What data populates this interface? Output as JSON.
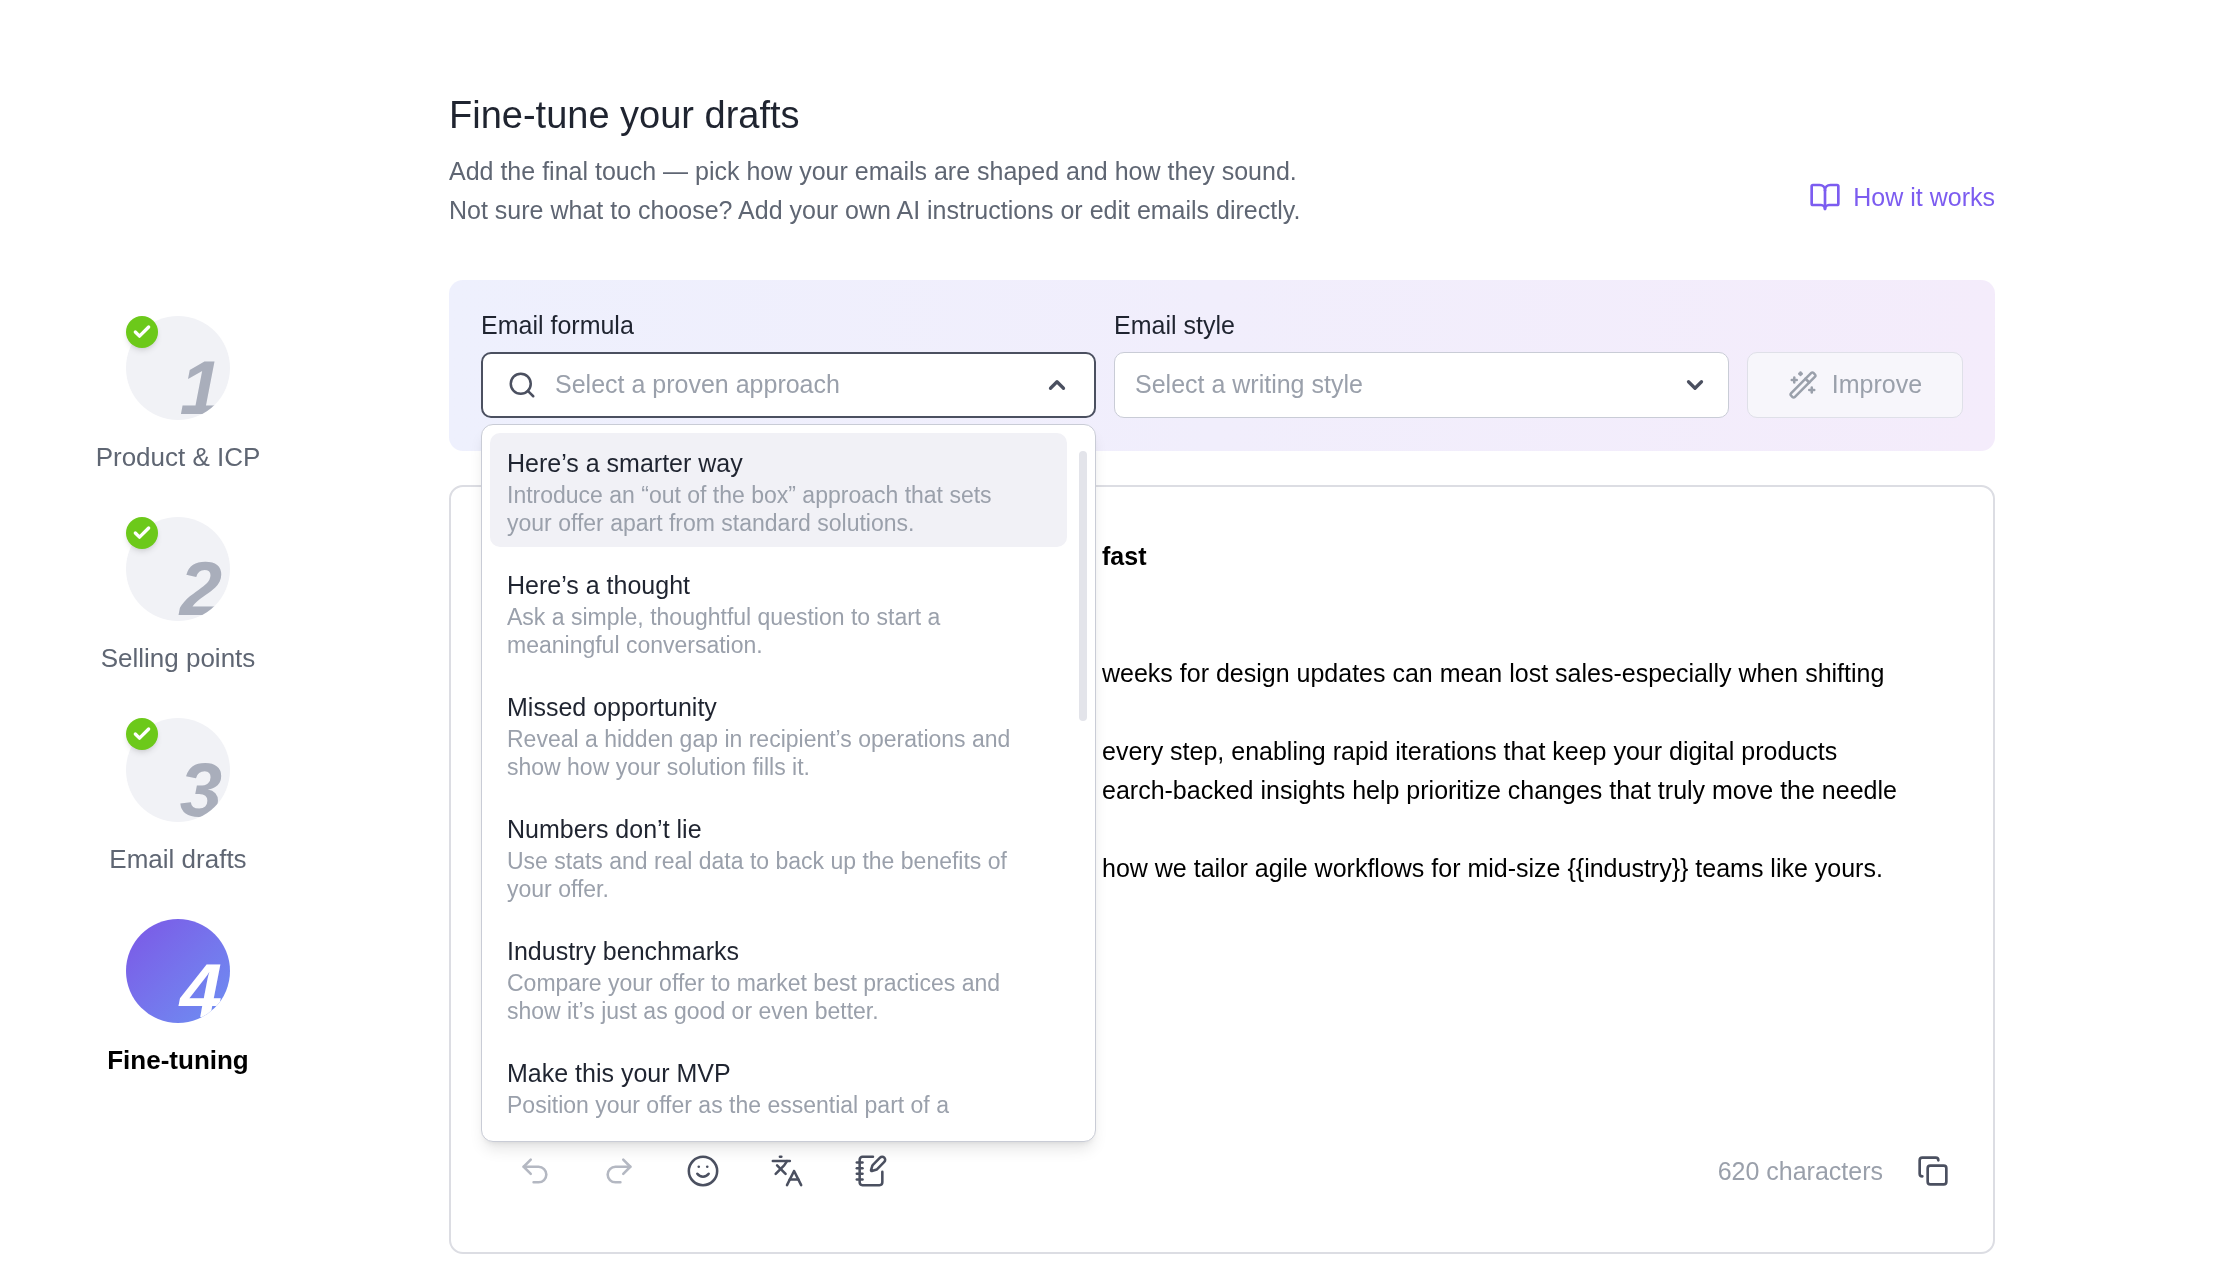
{
  "steps": [
    {
      "number": "1",
      "label": "Product & ICP",
      "completed": true,
      "selected": false
    },
    {
      "number": "2",
      "label": "Selling points",
      "completed": true,
      "selected": false
    },
    {
      "number": "3",
      "label": "Email drafts",
      "completed": true,
      "selected": false
    },
    {
      "number": "4",
      "label": "Fine-tuning",
      "completed": false,
      "selected": true
    }
  ],
  "header": {
    "title": "Fine-tune your drafts",
    "subtitle_lines": [
      "Add the final touch — pick how your emails are shaped and how they sound.",
      "Not sure what to choose? Add your own AI instructions or edit emails directly."
    ],
    "help_link": "How it works"
  },
  "formula": {
    "label": "Email formula",
    "placeholder": "Select a proven approach",
    "expanded": true,
    "options": [
      {
        "title": "Here’s a smarter way",
        "description": "Introduce an “out of the box” approach that sets your offer apart from standard solutions.",
        "selected": true
      },
      {
        "title": "Here’s a thought",
        "description": "Ask a simple, thoughtful question to start a meaningful conversation.",
        "selected": false
      },
      {
        "title": "Missed opportunity",
        "description": "Reveal a hidden gap in recipient’s operations and show how your solution fills it.",
        "selected": false
      },
      {
        "title": "Numbers don’t lie",
        "description": "Use stats and real data to back up the benefits of your offer.",
        "selected": false
      },
      {
        "title": "Industry benchmarks",
        "description": "Compare your offer to market best practices and show it’s just as good or even better.",
        "selected": false
      },
      {
        "title": "Make this your MVP",
        "description": "Position your offer as the essential part of a",
        "selected": false
      }
    ]
  },
  "style": {
    "label": "Email style",
    "placeholder": "Select a writing style",
    "expanded": false
  },
  "improve_button": {
    "label": "Improve",
    "disabled": true
  },
  "editor": {
    "paragraphs": [
      {
        "kind": "subject",
        "lines": [
          "fast"
        ]
      },
      {
        "kind": "body",
        "lines": [
          "weeks for design updates can mean lost sales-especially when shifting"
        ]
      },
      {
        "kind": "body",
        "lines": [
          "every step, enabling rapid iterations that keep your digital products",
          "earch-backed insights help prioritize changes that truly move the needle"
        ]
      },
      {
        "kind": "body",
        "lines": [
          "how we tailor agile workflows for mid-size {{industry}} teams like yours."
        ]
      }
    ],
    "tools": [
      {
        "kind": "undo",
        "disabled": true
      },
      {
        "kind": "redo",
        "disabled": true
      },
      {
        "kind": "emoji",
        "disabled": false
      },
      {
        "kind": "translate",
        "disabled": false
      },
      {
        "kind": "notes",
        "disabled": false
      }
    ],
    "char_count": "620 characters"
  }
}
